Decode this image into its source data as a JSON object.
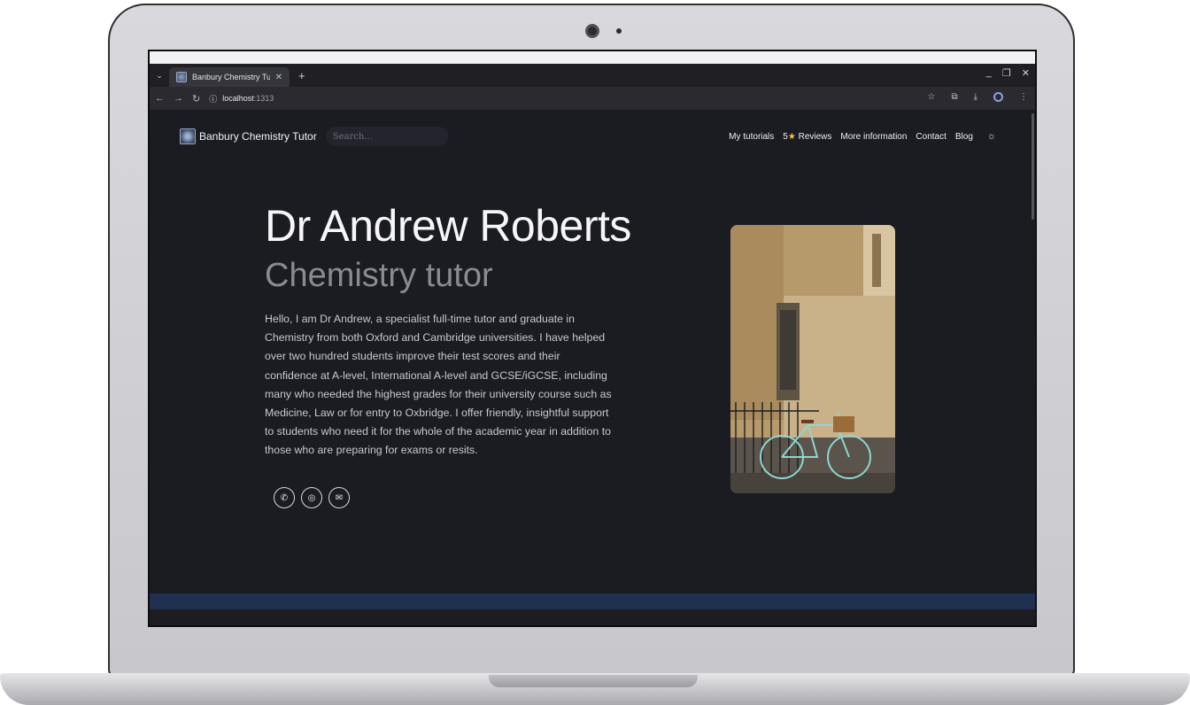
{
  "browser": {
    "tab_title": "Banbury Chemistry Tutor",
    "url_host": "localhost",
    "url_port": ":1313"
  },
  "site": {
    "brand_name": "Banbury Chemistry Tutor",
    "search_placeholder": "Search...",
    "nav": {
      "tutorials": "My tutorials",
      "reviews_count": "5",
      "reviews_label": "Reviews",
      "more_info": "More information",
      "contact": "Contact",
      "blog": "Blog"
    }
  },
  "hero": {
    "title": "Dr Andrew Roberts",
    "subtitle": "Chemistry tutor",
    "body": "Hello, I am Dr Andrew, a specialist full-time tutor and graduate in Chemistry from both Oxford and Cambridge universities. I have helped over two hundred students improve their test scores and their confidence at A-level, International A-level and GCSE/iGCSE, including many who needed the highest grades for their university course such as Medicine, Law or for entry to Oxbridge. I offer friendly, insightful support to students who need it for the whole of the academic year in addition to those who are preparing for exams or resits."
  },
  "socials": [
    {
      "icon": "whatsapp-icon",
      "glyph": "✆"
    },
    {
      "icon": "instagram-icon",
      "glyph": "◎"
    },
    {
      "icon": "email-icon",
      "glyph": "✉"
    }
  ],
  "icons": {
    "star": "★",
    "theme": "☼",
    "back": "←",
    "forward": "→",
    "reload": "↻",
    "info": "ⓘ",
    "bookmark": "☆",
    "extensions": "⧉",
    "download": "⤓",
    "menu": "⋮",
    "tab_close": "✕",
    "new_tab": "+",
    "tab_menu": "⌄",
    "minimize": "_",
    "restore": "❐",
    "close": "✕"
  },
  "colors": {
    "page_bg": "#1b1c22",
    "footer_band": "#1f3050",
    "star": "#f6c542"
  }
}
